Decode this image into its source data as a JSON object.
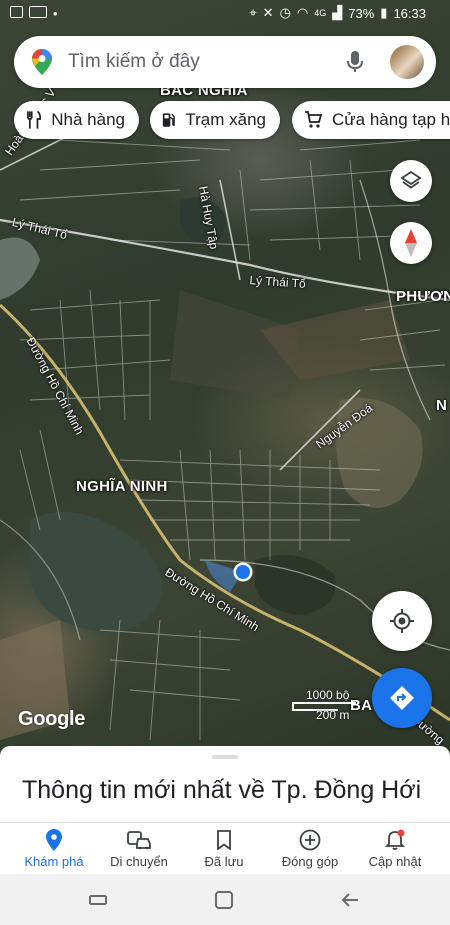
{
  "status_bar": {
    "battery": "73%",
    "time": "16:33",
    "network": "4G"
  },
  "search": {
    "placeholder": "Tìm kiếm ở đây",
    "icons": [
      "maps-pin-icon",
      "mic-icon",
      "avatar"
    ]
  },
  "chips": [
    {
      "label": "Nhà hàng",
      "icon": "restaurant-icon"
    },
    {
      "label": "Trạm xăng",
      "icon": "gas-station-icon"
    },
    {
      "label": "Cửa hàng tạp h",
      "icon": "cart-icon"
    }
  ],
  "map": {
    "labels": {
      "bac_nghia": "BẮC NGHĨA",
      "hoang_quoc_viet": "Hoàng Quốc V",
      "ly_thai_to_1": "Lý Thái Tổ",
      "ha_huy_tap": "Hà Huy Tập",
      "ly_thai_to_2": "Lý Thái Tổ",
      "phuong": "PHƯƠN",
      "duong_hcm_1": "Đường Hồ Chí Minh",
      "nguyen_doa": "Nguyễn Đoá",
      "n_right": "N",
      "nghia_ninh": "NGHĨA NINH",
      "duong_hcm_2": "Đường Hồ Chí Minh",
      "ba": "BA",
      "duong_right": "Đường"
    },
    "scale": {
      "top": "1000 bộ",
      "bottom": "200 m"
    },
    "logo": "Google",
    "colors": {
      "location_dot": "#1a73e8",
      "directions_fab": "#1a73e8"
    }
  },
  "sheet": {
    "title": "Thông tin mới nhất về Tp. Đồng Hới"
  },
  "nav": [
    {
      "label": "Khám phá",
      "icon": "explore-pin-icon",
      "active": true
    },
    {
      "label": "Di chuyển",
      "icon": "commute-icon",
      "active": false
    },
    {
      "label": "Đã lưu",
      "icon": "bookmark-icon",
      "active": false
    },
    {
      "label": "Đóng góp",
      "icon": "add-circle-icon",
      "active": false
    },
    {
      "label": "Cập nhật",
      "icon": "bell-icon",
      "active": false
    }
  ]
}
